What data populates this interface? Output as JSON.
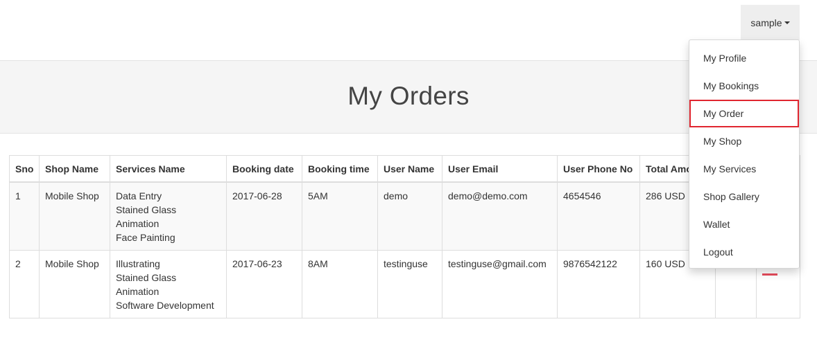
{
  "navbar": {
    "user_label": "sample"
  },
  "hero": {
    "title": "My Orders"
  },
  "table": {
    "headers": [
      "Sno",
      "Shop Name",
      "Services Name",
      "Booking date",
      "Booking time",
      "User Name",
      "User Email",
      "User Phone No",
      "Total Amount",
      "",
      ""
    ],
    "rows": [
      {
        "sno": "1",
        "shop": "Mobile Shop",
        "services": [
          "Data Entry",
          "Stained Glass",
          "Animation",
          "Face Painting"
        ],
        "date": "2017-06-28",
        "time": "5AM",
        "user": "demo",
        "email": "demo@demo.com",
        "phone": "4654546",
        "total": "286 USD"
      },
      {
        "sno": "2",
        "shop": "Mobile Shop",
        "services": [
          "Illustrating",
          "Stained Glass",
          "Animation",
          "Software Development"
        ],
        "date": "2017-06-23",
        "time": "8AM",
        "user": "testinguse",
        "email": "testinguse@gmail.com",
        "phone": "9876542122",
        "total": "160 USD"
      }
    ]
  },
  "dropdown": {
    "items": [
      "My Profile",
      "My Bookings",
      "My Order",
      "My Shop",
      "My Services",
      "Shop Gallery",
      "Wallet",
      "Logout"
    ],
    "highlighted": "My Order"
  },
  "colors": {
    "highlight_border": "#e0252f",
    "hero_bg": "#f5f5f5",
    "toggle_bg": "#eeeeee"
  }
}
